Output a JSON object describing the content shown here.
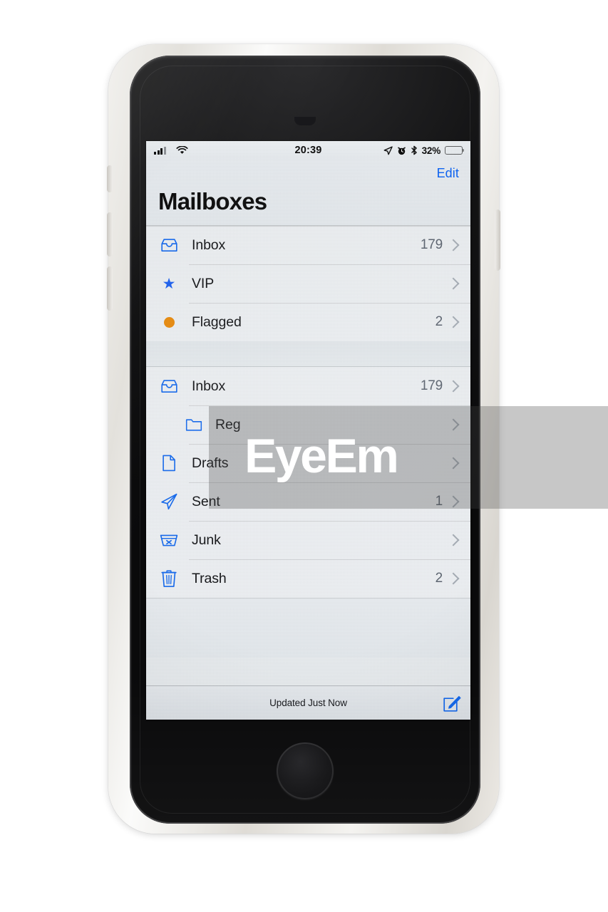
{
  "status_bar": {
    "signal_icon": "cellular-signal-icon",
    "wifi_icon": "wifi-icon",
    "time": "20:39",
    "location_icon": "location-arrow-icon",
    "alarm_icon": "alarm-clock-icon",
    "bluetooth_icon": "bluetooth-icon",
    "battery_percent": "32%",
    "battery_icon": "battery-icon",
    "battery_level": 32
  },
  "nav": {
    "edit_label": "Edit",
    "title": "Mailboxes"
  },
  "sections": [
    {
      "rows": [
        {
          "icon": "inbox-tray-icon",
          "label": "Inbox",
          "count": "179",
          "indented": false
        },
        {
          "icon": "star-icon",
          "label": "VIP",
          "count": "",
          "indented": false
        },
        {
          "icon": "flag-dot-icon",
          "label": "Flagged",
          "count": "2",
          "indented": false
        }
      ]
    },
    {
      "rows": [
        {
          "icon": "inbox-tray-icon",
          "label": "Inbox",
          "count": "179",
          "indented": false
        },
        {
          "icon": "folder-icon",
          "label": "Reg",
          "count": "",
          "indented": true
        },
        {
          "icon": "document-icon",
          "label": "Drafts",
          "count": "",
          "indented": false
        },
        {
          "icon": "paper-plane-icon",
          "label": "Sent",
          "count": "1",
          "indented": false
        },
        {
          "icon": "junk-bin-icon",
          "label": "Junk",
          "count": "",
          "indented": false
        },
        {
          "icon": "trash-can-icon",
          "label": "Trash",
          "count": "2",
          "indented": false
        }
      ]
    }
  ],
  "toolbar": {
    "updated_label": "Updated Just Now",
    "compose_icon": "compose-icon"
  },
  "watermark": {
    "text": "EyeEm"
  },
  "colors": {
    "accent_blue": "#1268ef",
    "link_blue": "#0a62f5",
    "flag_orange": "#e98a0b",
    "screen_bg": "#e9edf0"
  }
}
